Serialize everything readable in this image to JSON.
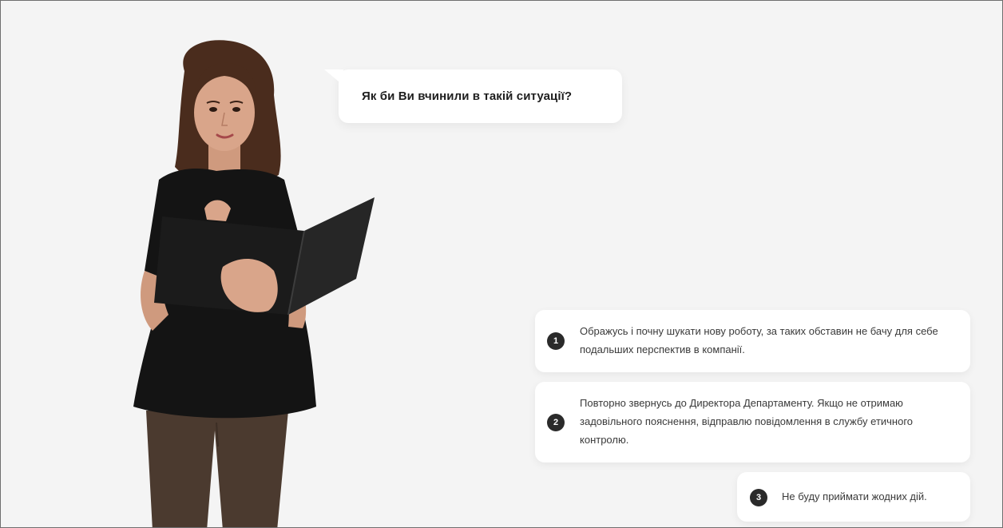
{
  "scene": {
    "background_color": "#f4f4f4",
    "character": {
      "icon": "woman-with-folder-illustration",
      "colors": {
        "hair": "#4a2c1d",
        "skin": "#d9a58a",
        "top": "#141414",
        "trousers": "#4b3a2f",
        "folder": "#1b1b1b"
      }
    }
  },
  "question": {
    "text": "Як би Ви вчинили в такій ситуації?"
  },
  "answers": [
    {
      "number": "1",
      "text": "Ображусь і почну шукати нову роботу, за таких обставин не бачу для себе подальших перспектив в компанії."
    },
    {
      "number": "2",
      "text": "Повторно звернусь до Директора Департаменту. Якщо не отримаю задовільного пояснення, відправлю повідомлення в службу етичного контролю."
    },
    {
      "number": "3",
      "text": "Не буду приймати жодних дій."
    }
  ]
}
